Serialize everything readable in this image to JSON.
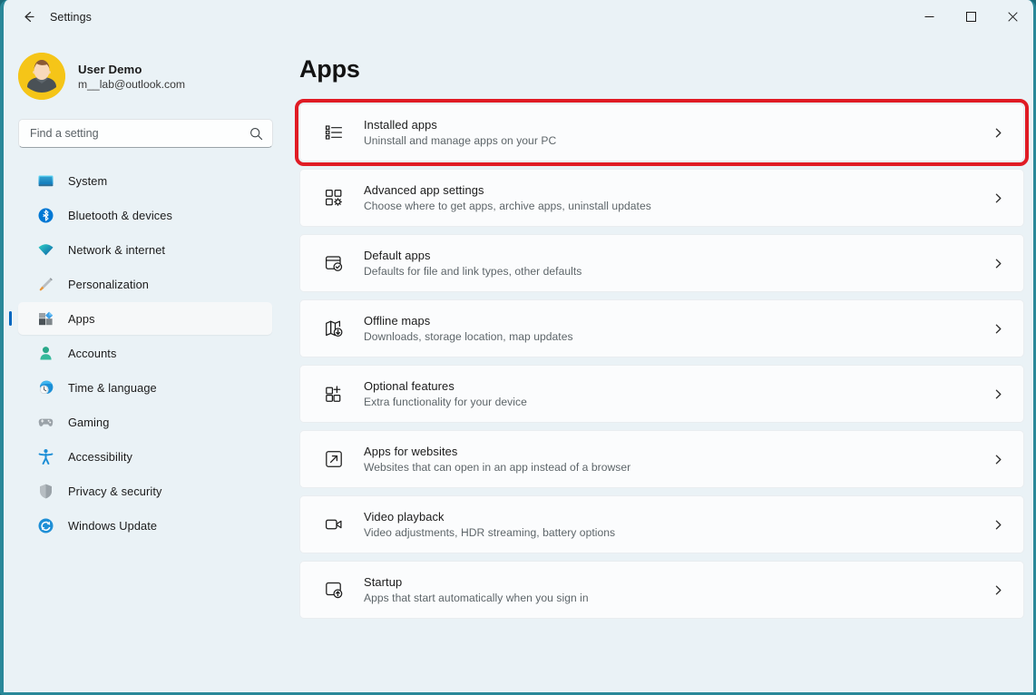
{
  "window": {
    "app_title": "Settings",
    "back_icon": "arrow-left-icon",
    "controls": {
      "minimize": "minimize-icon",
      "maximize": "maximize-icon",
      "close": "close-icon"
    }
  },
  "colors": {
    "window_background": "#eaf2f6",
    "window_frame": "#2a8899",
    "card_background": "#fbfcfd",
    "accent": "#0067c0",
    "highlight_border": "#e01b24",
    "avatar_background": "#f5c518"
  },
  "sidebar": {
    "account": {
      "name": "User Demo",
      "email": "m__lab@outlook.com",
      "avatar_icon": "user-avatar"
    },
    "search": {
      "placeholder": "Find a setting",
      "value": "",
      "icon": "search-icon"
    },
    "items": [
      {
        "label": "System",
        "icon": "system-icon",
        "selected": false
      },
      {
        "label": "Bluetooth & devices",
        "icon": "bluetooth-icon",
        "selected": false
      },
      {
        "label": "Network & internet",
        "icon": "network-icon",
        "selected": false
      },
      {
        "label": "Personalization",
        "icon": "personalization-icon",
        "selected": false
      },
      {
        "label": "Apps",
        "icon": "apps-icon",
        "selected": true
      },
      {
        "label": "Accounts",
        "icon": "accounts-icon",
        "selected": false
      },
      {
        "label": "Time & language",
        "icon": "time-language-icon",
        "selected": false
      },
      {
        "label": "Gaming",
        "icon": "gaming-icon",
        "selected": false
      },
      {
        "label": "Accessibility",
        "icon": "accessibility-icon",
        "selected": false
      },
      {
        "label": "Privacy & security",
        "icon": "privacy-security-icon",
        "selected": false
      },
      {
        "label": "Windows Update",
        "icon": "windows-update-icon",
        "selected": false
      }
    ]
  },
  "main": {
    "page_title": "Apps",
    "cards": [
      {
        "title": "Installed apps",
        "subtitle": "Uninstall and manage apps on your PC",
        "icon": "installed-apps-list-icon",
        "chevron": "chevron-right-icon",
        "highlighted": true
      },
      {
        "title": "Advanced app settings",
        "subtitle": "Choose where to get apps, archive apps, uninstall updates",
        "icon": "advanced-app-settings-icon",
        "chevron": "chevron-right-icon",
        "highlighted": false
      },
      {
        "title": "Default apps",
        "subtitle": "Defaults for file and link types, other defaults",
        "icon": "default-apps-icon",
        "chevron": "chevron-right-icon",
        "highlighted": false
      },
      {
        "title": "Offline maps",
        "subtitle": "Downloads, storage location, map updates",
        "icon": "offline-maps-icon",
        "chevron": "chevron-right-icon",
        "highlighted": false
      },
      {
        "title": "Optional features",
        "subtitle": "Extra functionality for your device",
        "icon": "optional-features-icon",
        "chevron": "chevron-right-icon",
        "highlighted": false
      },
      {
        "title": "Apps for websites",
        "subtitle": "Websites that can open in an app instead of a browser",
        "icon": "apps-for-websites-icon",
        "chevron": "chevron-right-icon",
        "highlighted": false
      },
      {
        "title": "Video playback",
        "subtitle": "Video adjustments, HDR streaming, battery options",
        "icon": "video-playback-icon",
        "chevron": "chevron-right-icon",
        "highlighted": false
      },
      {
        "title": "Startup",
        "subtitle": "Apps that start automatically when you sign in",
        "icon": "startup-icon",
        "chevron": "chevron-right-icon",
        "highlighted": false
      }
    ]
  }
}
